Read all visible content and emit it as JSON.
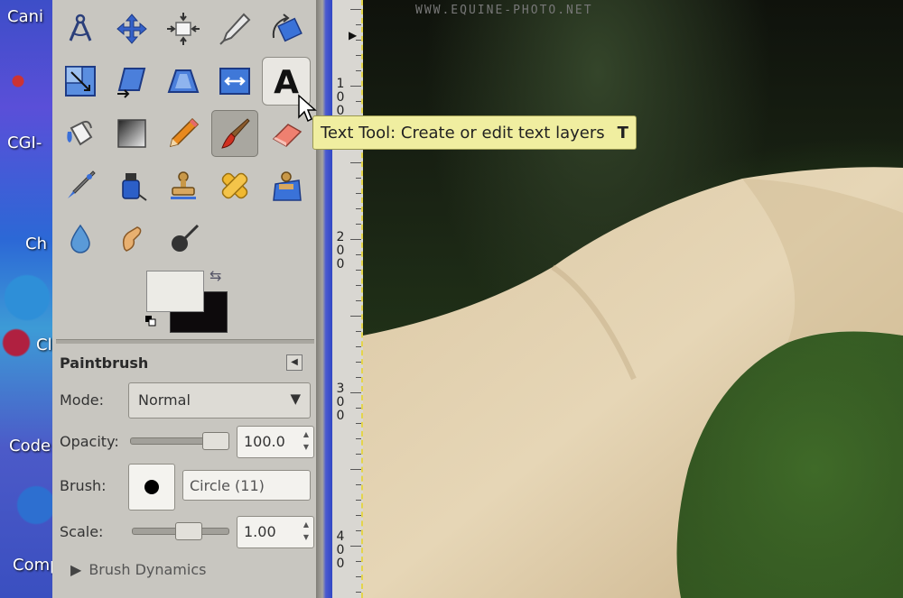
{
  "desktop": {
    "labels": [
      "Cani",
      "CGI-",
      "Ch",
      "Cl",
      "Code",
      "Comp"
    ]
  },
  "toolbox": {
    "tools": [
      {
        "id": "paths",
        "icon": "compass-icon"
      },
      {
        "id": "move",
        "icon": "move-arrows-icon"
      },
      {
        "id": "align",
        "icon": "align-icon"
      },
      {
        "id": "ink",
        "icon": "pen-nib-icon"
      },
      {
        "id": "crop-rotate",
        "icon": "rotate-icon"
      },
      {
        "id": "scale",
        "icon": "scale-icon"
      },
      {
        "id": "shear",
        "icon": "shear-icon"
      },
      {
        "id": "perspective",
        "icon": "perspective-icon"
      },
      {
        "id": "flip",
        "icon": "flip-icon"
      },
      {
        "id": "text",
        "icon": "text-tool-icon",
        "glyph": "A"
      },
      {
        "id": "bucket",
        "icon": "bucket-fill-icon"
      },
      {
        "id": "gradient",
        "icon": "gradient-icon"
      },
      {
        "id": "pencil",
        "icon": "pencil-icon"
      },
      {
        "id": "paintbrush",
        "icon": "paintbrush-icon"
      },
      {
        "id": "eraser",
        "icon": "eraser-icon"
      },
      {
        "id": "airbrush",
        "icon": "airbrush-icon"
      },
      {
        "id": "ink-bottle",
        "icon": "ink-icon"
      },
      {
        "id": "clone",
        "icon": "clone-stamp-icon"
      },
      {
        "id": "heal",
        "icon": "heal-bandage-icon"
      },
      {
        "id": "perspective-clone",
        "icon": "perspective-clone-icon"
      },
      {
        "id": "blur",
        "icon": "blur-drop-icon"
      },
      {
        "id": "smudge",
        "icon": "smudge-icon"
      },
      {
        "id": "dodge",
        "icon": "dodge-burn-icon"
      }
    ],
    "active_tool": "paintbrush",
    "hover_tool": "text",
    "colors": {
      "foreground": "#ecebe6",
      "background": "#0d0a0c"
    }
  },
  "tool_options": {
    "title": "Paintbrush",
    "mode_label": "Mode:",
    "mode_value": "Normal",
    "opacity_label": "Opacity:",
    "opacity_value": "100.0",
    "opacity_fraction": 1.0,
    "brush_label": "Brush:",
    "brush_name": "Circle (11)",
    "scale_label": "Scale:",
    "scale_value": "1.00",
    "brush_dynamics_label": "Brush Dynamics"
  },
  "tooltip": {
    "text": "Text Tool: Create or edit text layers",
    "shortcut": "T"
  },
  "ruler": {
    "marks": [
      {
        "digits": [
          "1",
          "0",
          "0"
        ]
      },
      {
        "digits": [
          "2",
          "0",
          "0"
        ]
      },
      {
        "digits": [
          "3",
          "0",
          "0"
        ]
      },
      {
        "digits": [
          "4",
          "0",
          "0"
        ]
      }
    ]
  },
  "canvas": {
    "watermark": "WWW.EQUINE-PHOTO.NET"
  }
}
